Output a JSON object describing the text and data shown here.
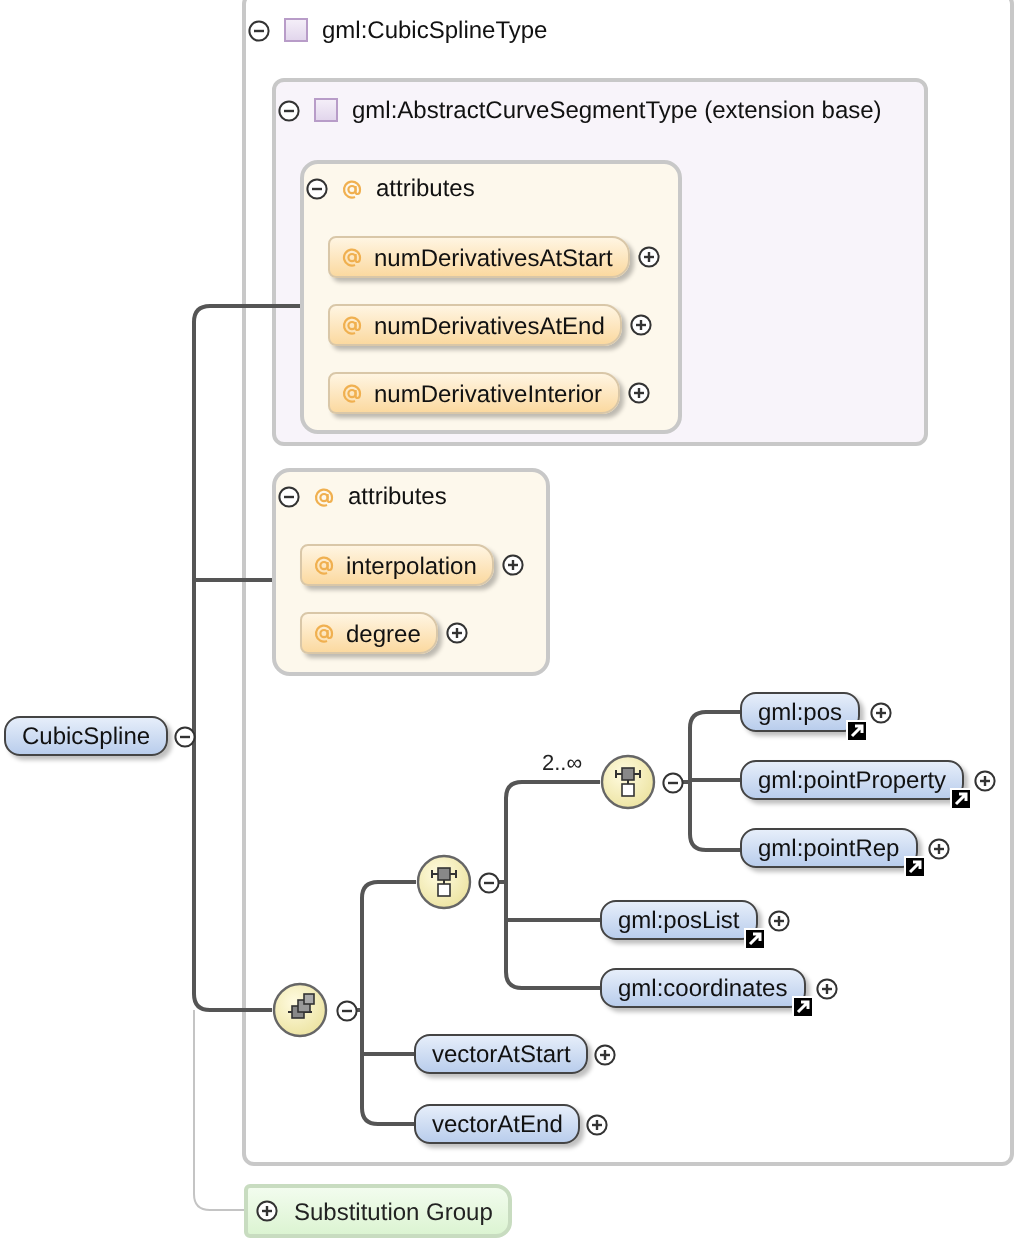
{
  "root": {
    "label": "CubicSpline",
    "expanded": true
  },
  "complex_type": {
    "title": "gml:CubicSplineType",
    "expanded": true
  },
  "base_type": {
    "title": "gml:AbstractCurveSegmentType (extension base)",
    "expanded": true
  },
  "attribute_groups": [
    {
      "title": "attributes",
      "expanded": true,
      "attributes": [
        {
          "name": "numDerivativesAtStart",
          "expanded": false
        },
        {
          "name": "numDerivativesAtEnd",
          "expanded": false
        },
        {
          "name": "numDerivativeInterior",
          "expanded": false
        }
      ]
    },
    {
      "title": "attributes",
      "expanded": true,
      "attributes": [
        {
          "name": "interpolation",
          "expanded": false
        },
        {
          "name": "degree",
          "expanded": false
        }
      ]
    }
  ],
  "sequence": {
    "expanded": true,
    "elements": [
      {
        "name": "vectorAtStart",
        "reference": false,
        "expanded": false
      },
      {
        "name": "vectorAtEnd",
        "reference": false,
        "expanded": false
      }
    ]
  },
  "choice": {
    "expanded": true,
    "elements": [
      {
        "name": "gml:posList",
        "reference": true,
        "expanded": false
      },
      {
        "name": "gml:coordinates",
        "reference": true,
        "expanded": false
      }
    ]
  },
  "inner_choice": {
    "occurs": "2..∞",
    "expanded": true,
    "elements": [
      {
        "name": "gml:pos",
        "reference": true,
        "expanded": false
      },
      {
        "name": "gml:pointProperty",
        "reference": true,
        "expanded": false
      },
      {
        "name": "gml:pointRep",
        "reference": true,
        "expanded": false
      }
    ]
  },
  "substitution_group": {
    "label": "Substitution Group",
    "expanded": false
  }
}
